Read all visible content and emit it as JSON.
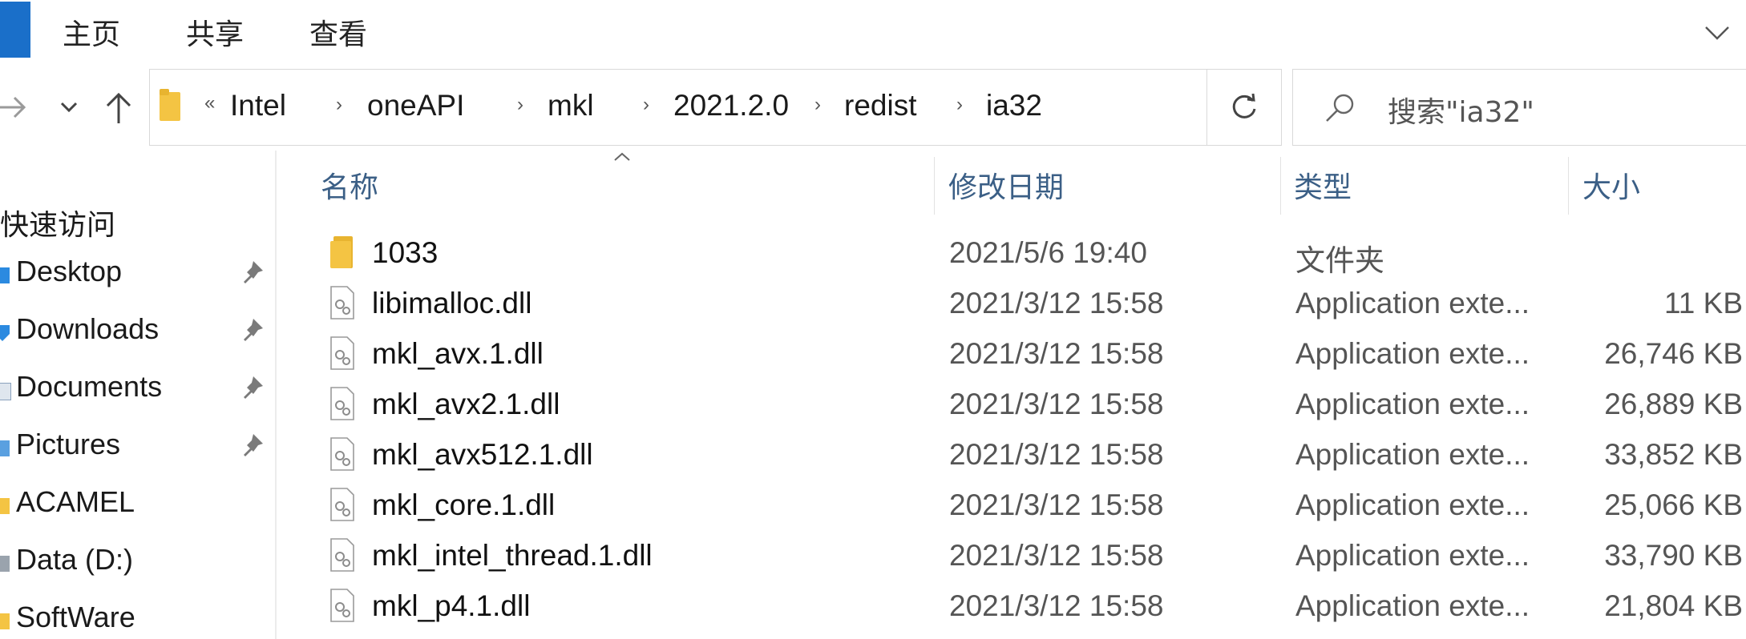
{
  "ribbon": {
    "tabs": [
      "主页",
      "共享",
      "查看"
    ]
  },
  "address": {
    "overflow": "«",
    "crumbs": [
      "Intel",
      "oneAPI",
      "mkl",
      "2021.2.0",
      "redist",
      "ia32"
    ]
  },
  "search": {
    "placeholder": "搜索\"ia32\""
  },
  "sidebar": {
    "quick_access": "快速访问",
    "items": [
      {
        "label": "Desktop",
        "icon": "desktop-icon",
        "pinned": true
      },
      {
        "label": "Downloads",
        "icon": "downloads-icon",
        "pinned": true
      },
      {
        "label": "Documents",
        "icon": "documents-icon",
        "pinned": true
      },
      {
        "label": "Pictures",
        "icon": "pictures-icon",
        "pinned": true
      },
      {
        "label": "ACAMEL",
        "icon": "folder-icon",
        "pinned": false
      },
      {
        "label": "Data (D:)",
        "icon": "drive-icon",
        "pinned": false
      },
      {
        "label": "SoftWare",
        "icon": "folder-icon",
        "pinned": false
      }
    ]
  },
  "columns": {
    "name": "名称",
    "date": "修改日期",
    "type": "类型",
    "size": "大小"
  },
  "files": [
    {
      "name": "1033",
      "date": "2021/5/6 19:40",
      "type": "文件夹",
      "size": "",
      "icon": "folder-icon"
    },
    {
      "name": "libimalloc.dll",
      "date": "2021/3/12 15:58",
      "type": "Application exte...",
      "size": "11 KB",
      "icon": "dll-file-icon"
    },
    {
      "name": "mkl_avx.1.dll",
      "date": "2021/3/12 15:58",
      "type": "Application exte...",
      "size": "26,746 KB",
      "icon": "dll-file-icon"
    },
    {
      "name": "mkl_avx2.1.dll",
      "date": "2021/3/12 15:58",
      "type": "Application exte...",
      "size": "26,889 KB",
      "icon": "dll-file-icon"
    },
    {
      "name": "mkl_avx512.1.dll",
      "date": "2021/3/12 15:58",
      "type": "Application exte...",
      "size": "33,852 KB",
      "icon": "dll-file-icon"
    },
    {
      "name": "mkl_core.1.dll",
      "date": "2021/3/12 15:58",
      "type": "Application exte...",
      "size": "25,066 KB",
      "icon": "dll-file-icon"
    },
    {
      "name": "mkl_intel_thread.1.dll",
      "date": "2021/3/12 15:58",
      "type": "Application exte...",
      "size": "33,790 KB",
      "icon": "dll-file-icon"
    },
    {
      "name": "mkl_p4.1.dll",
      "date": "2021/3/12 15:58",
      "type": "Application exte...",
      "size": "21,804 KB",
      "icon": "dll-file-icon"
    }
  ],
  "colors": {
    "accent": "#1a6fc9",
    "header_text": "#3b5f86",
    "folder": "#f4c443"
  }
}
